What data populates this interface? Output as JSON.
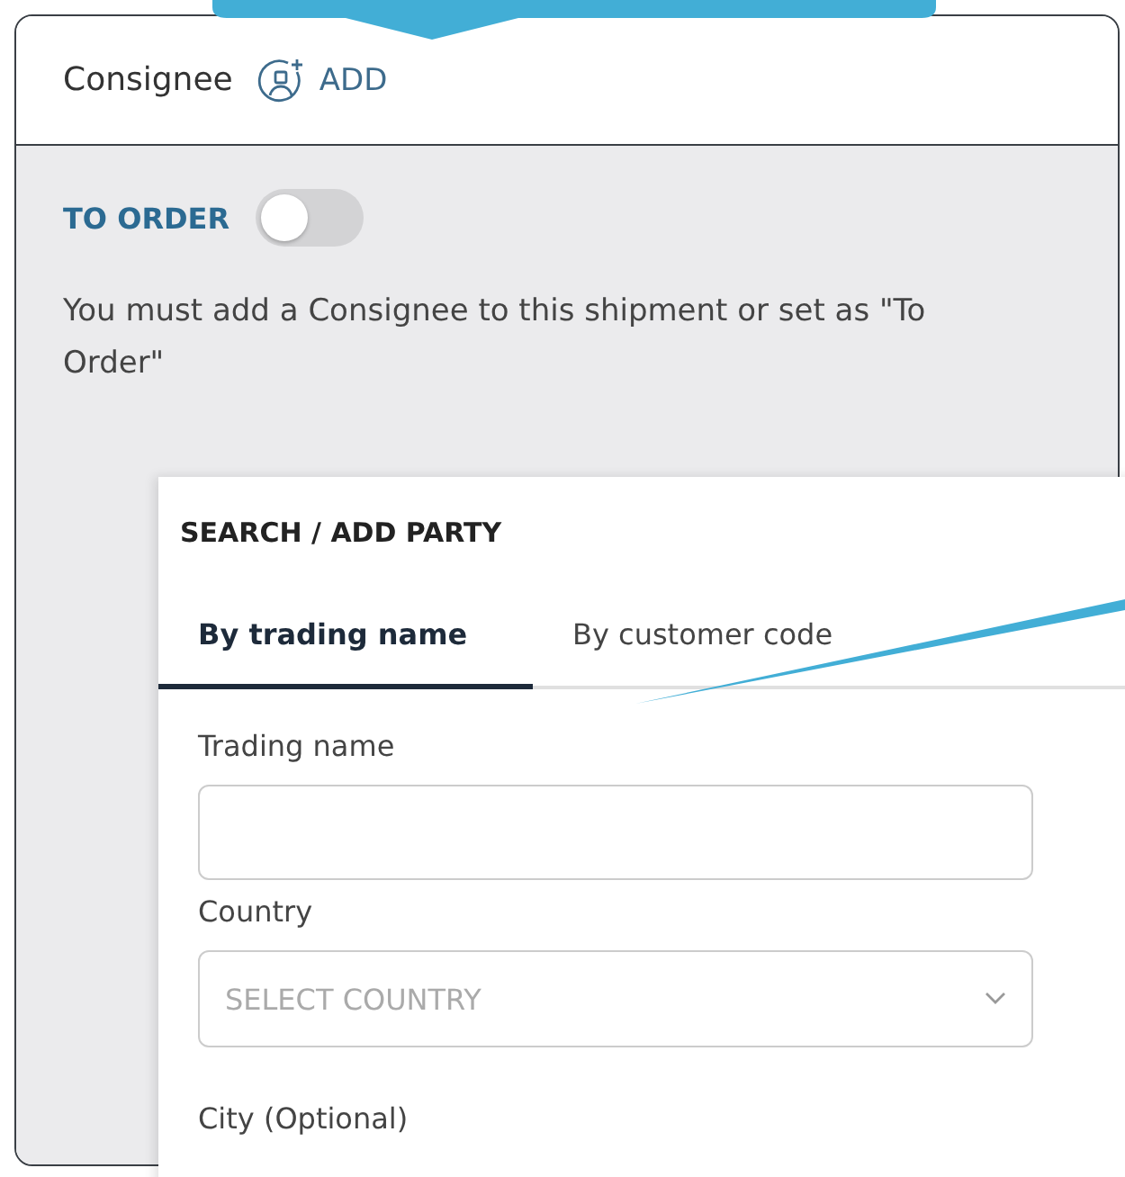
{
  "consignee": {
    "title": "Consignee",
    "add_label": "ADD",
    "to_order": {
      "label": "TO ORDER",
      "on": false
    },
    "message": "You must add a Consignee to this shipment or set as \"To Order\""
  },
  "party_dialog": {
    "title": "SEARCH / ADD PARTY",
    "tabs": [
      {
        "label": "By trading name",
        "selected": true
      },
      {
        "label": "By customer code",
        "selected": false
      }
    ],
    "fields": [
      {
        "kind": "text",
        "label": "Trading name"
      },
      {
        "kind": "select",
        "label": "Country",
        "placeholder": "SELECT COUNTRY"
      },
      {
        "kind": "label",
        "label": "City (Optional)"
      }
    ]
  }
}
